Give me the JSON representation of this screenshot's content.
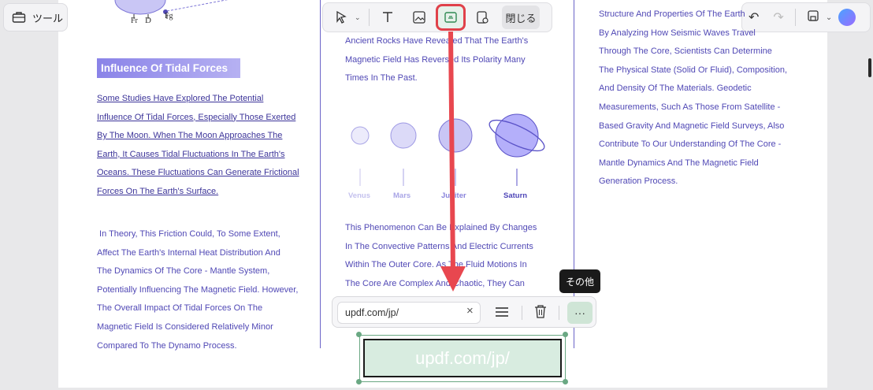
{
  "tools": {
    "label": "ツール"
  },
  "toolbar": {
    "close_label": "閉じる"
  },
  "left_column": {
    "heading": "Influence Of Tidal Forces",
    "diagram_labels": {
      "fr": "Fr",
      "d": "D",
      "fg": "Fg"
    },
    "underlined_lines": [
      "Some Studies Have Explored The Potential",
      "Influence Of Tidal Forces, Especially Those Exerted",
      "By The Moon. When The Moon Approaches The",
      "Earth, It Causes Tidal Fluctuations In The Earth's",
      "Oceans. These Fluctuations Can Generate Frictional",
      "Forces On The Earth's Surface."
    ],
    "para_lines": [
      " In Theory, This Friction Could, To Some Extent,",
      "Affect The Earth's Internal Heat Distribution And",
      "The Dynamics Of The Core - Mantle System,",
      "Potentially Influencing The Magnetic Field. However,",
      "The Overall Impact Of Tidal Forces On The",
      "Magnetic Field Is Considered Relatively Minor",
      "Compared To The Dynamo Process."
    ]
  },
  "middle_column": {
    "top_lines": [
      "Ancient Rocks Have Revealed That The Earth's",
      "Magnetic Field Has Reversed Its Polarity Many",
      "Times In The Past."
    ],
    "planets": [
      "Venus",
      "Mars",
      "Jupiter",
      "Saturn"
    ],
    "bottom_lines": [
      "This Phenomenon Can Be Explained By Changes",
      "In The Convective Patterns And Electric Currents",
      "Within The Outer Core. As The Fluid Motions In",
      "The Core Are Complex And Chaotic, They Can"
    ]
  },
  "right_column": {
    "lines": [
      "Structure And Properties Of The Earth",
      "By Analyzing How Seismic Waves Travel",
      "Through The Core, Scientists Can Determine",
      "The Physical State (Solid Or Fluid), Composition,",
      "And Density Of The Materials. Geodetic",
      "Measurements, Such As Those From Satellite -",
      "Based Gravity And Magnetic Field Surveys, Also",
      "Contribute To Our Understanding Of The Core -",
      "Mantle Dynamics And The Magnetic Field",
      "Generation Process."
    ]
  },
  "link_bar": {
    "url_value": "updf.com/jp/",
    "tooltip": "その他",
    "more_label": "···"
  },
  "link_box": {
    "text": "updf.com/jp/"
  }
}
